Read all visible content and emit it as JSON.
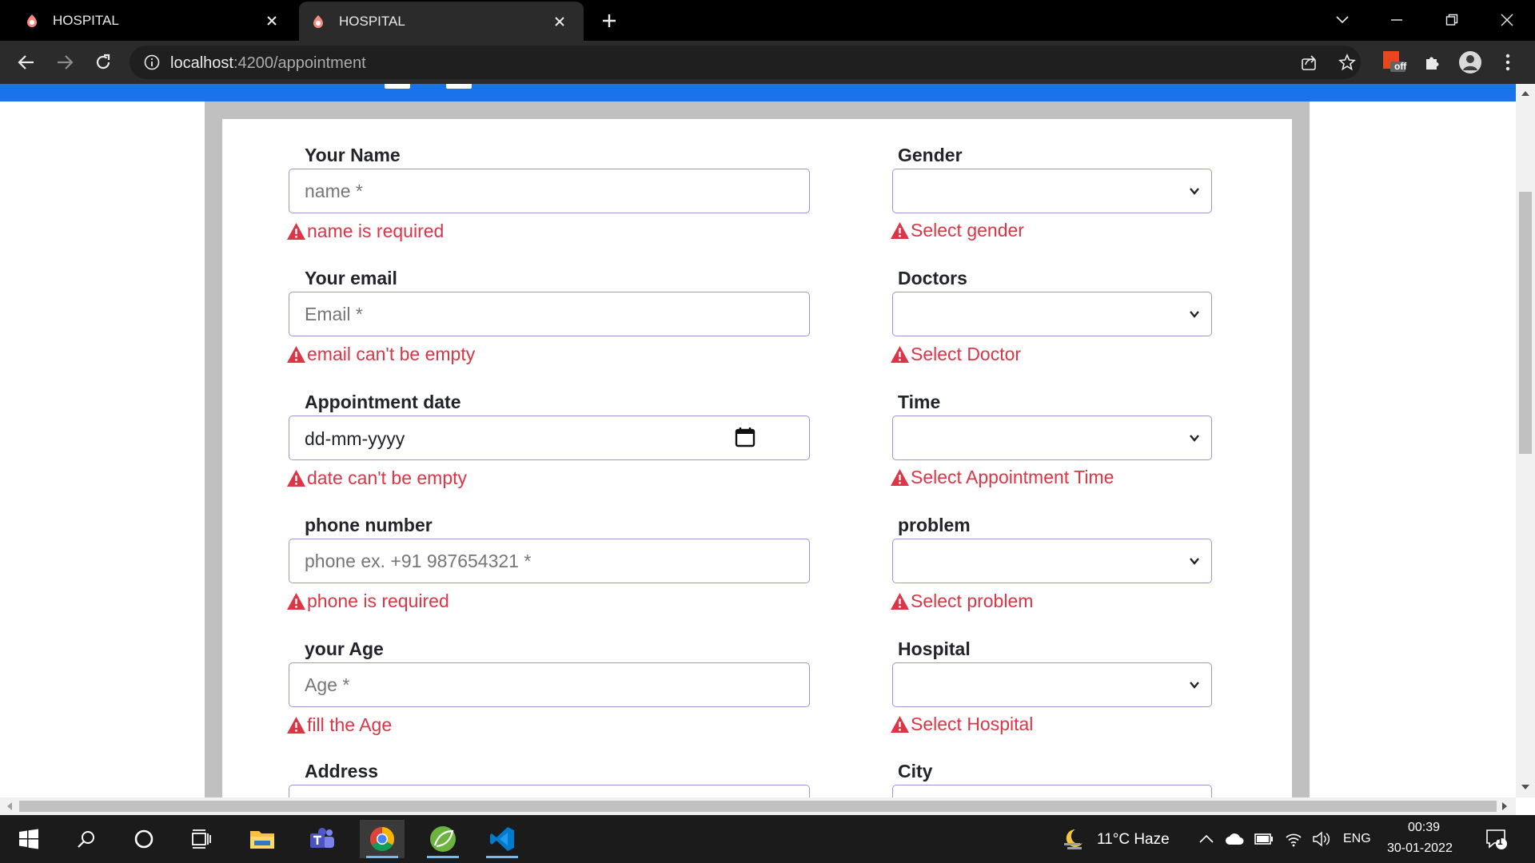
{
  "browser": {
    "tabs": [
      {
        "title": "HOSPITAL",
        "active": false
      },
      {
        "title": "HOSPITAL",
        "active": true
      }
    ],
    "url_host": "localhost",
    "url_rest": ":4200/appointment",
    "pdf_badge": "off"
  },
  "form": {
    "left": [
      {
        "label": "Your Name",
        "placeholder": "name *",
        "error": "name is required"
      },
      {
        "label": "Your email",
        "placeholder": "Email *",
        "error": "email can't be empty"
      },
      {
        "label": "Appointment date",
        "value": "dd-mm-yyyy",
        "error": "date can't be empty"
      },
      {
        "label": "phone number",
        "placeholder": "phone ex. +91 987654321 *",
        "error": "phone is required"
      },
      {
        "label": "your Age",
        "placeholder": "Age *",
        "error": "fill the Age"
      },
      {
        "label": "Address"
      }
    ],
    "right": [
      {
        "label": "Gender",
        "value": "",
        "error": "Select gender"
      },
      {
        "label": "Doctors",
        "value": "",
        "error": "Select Doctor"
      },
      {
        "label": "Time",
        "value": "",
        "error": "Select Appointment Time"
      },
      {
        "label": "problem",
        "value": "",
        "error": "Select problem"
      },
      {
        "label": "Hospital",
        "value": "",
        "error": "Select Hospital"
      },
      {
        "label": "City"
      }
    ]
  },
  "taskbar": {
    "weather": "11°C  Haze",
    "language": "ENG",
    "time": "00:39",
    "date": "30-01-2022",
    "notification_count": "1"
  },
  "colors": {
    "accent_blue": "#1a73e8",
    "error_red": "#dc3545",
    "input_border": "#9e95d4"
  }
}
